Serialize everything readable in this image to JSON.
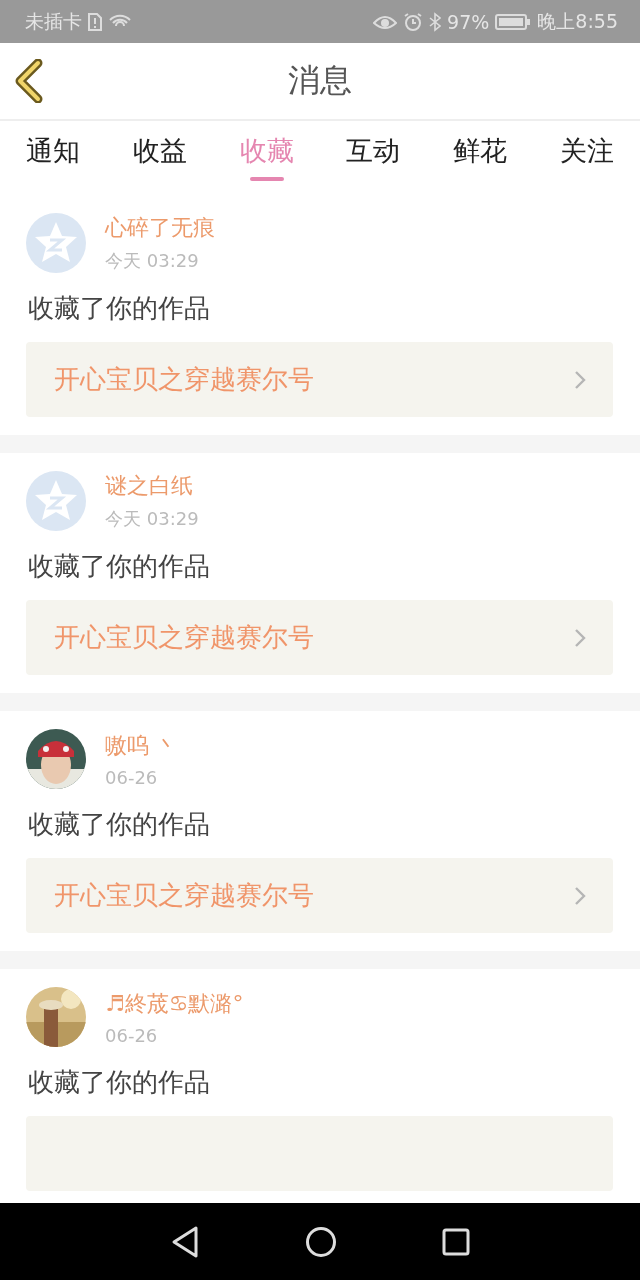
{
  "status_bar": {
    "carrier": "未插卡",
    "battery": "97%",
    "time": "晚上8:55"
  },
  "header": {
    "title": "消息"
  },
  "tabs": [
    {
      "label": "通知",
      "selected": false
    },
    {
      "label": "收益",
      "selected": false
    },
    {
      "label": "收藏",
      "selected": true
    },
    {
      "label": "互动",
      "selected": false
    },
    {
      "label": "鲜花",
      "selected": false
    },
    {
      "label": "关注",
      "selected": false
    }
  ],
  "messages": [
    {
      "kind": "default",
      "name": "心碎了无痕",
      "time": "今天 03:29",
      "text": "收藏了你的作品",
      "work": "开心宝贝之穿越赛尔号"
    },
    {
      "kind": "default",
      "name": "谜之白纸",
      "time": "今天 03:29",
      "text": "收藏了你的作品",
      "work": "开心宝贝之穿越赛尔号"
    },
    {
      "kind": "picture",
      "name": "嗷呜 丶",
      "time": "06-26",
      "text": "收藏了你的作品",
      "work": "开心宝贝之穿越赛尔号"
    },
    {
      "kind": "picture",
      "name": "♬終荿♋默潞°",
      "time": "06-26",
      "text": "收藏了你的作品"
    }
  ]
}
